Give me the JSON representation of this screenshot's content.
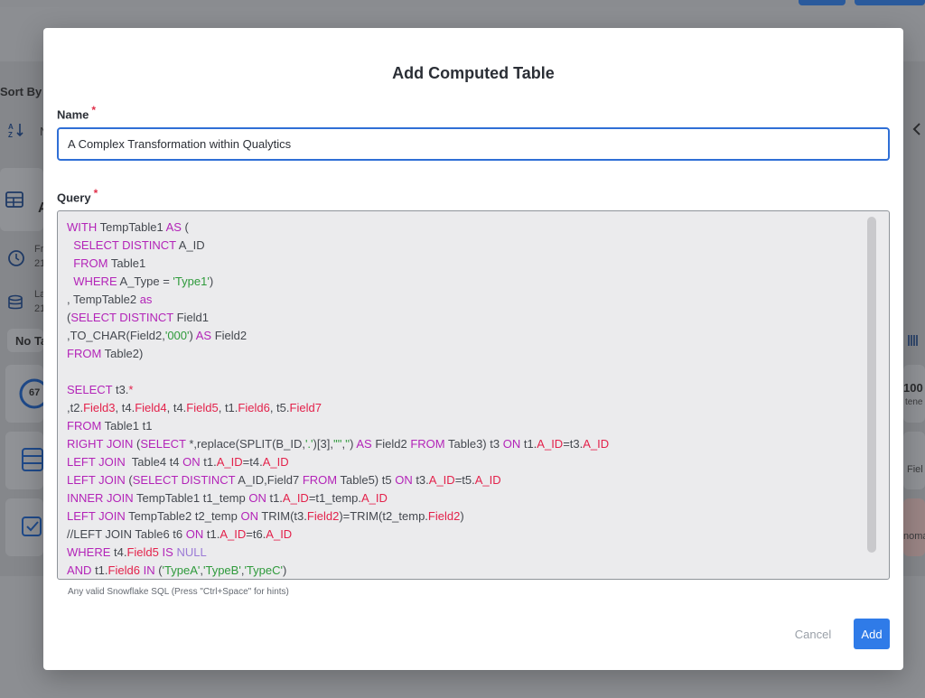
{
  "background": {
    "sort_label": "Sort By",
    "no_tags_label": "No Ta",
    "metric_value": "67",
    "right_metric": "100",
    "right_sub": "tene",
    "right_field": "Fiel",
    "right_anomaly": "noma",
    "side_letter": "A",
    "fr_label": "Fr",
    "fr_value": "21",
    "la_label": "La",
    "la_value": "21",
    "n_label": "N"
  },
  "modal": {
    "title": "Add Computed Table",
    "name_label": "Name",
    "name_value": "A Complex Transformation within Qualytics",
    "query_label": "Query",
    "required_mark": "*",
    "hint": "Any valid Snowflake SQL (Press \"Ctrl+Space\" for hints)",
    "cancel_label": "Cancel",
    "add_label": "Add"
  },
  "query_lines": [
    [
      {
        "t": "WITH",
        "c": "kw"
      },
      {
        "t": " TempTable1 ",
        "c": ""
      },
      {
        "t": "AS",
        "c": "kw"
      },
      {
        "t": " (",
        "c": ""
      }
    ],
    [
      {
        "t": "  SELECT DISTINCT",
        "c": "kw"
      },
      {
        "t": " A_ID",
        "c": ""
      }
    ],
    [
      {
        "t": "  FROM",
        "c": "kw"
      },
      {
        "t": " Table1",
        "c": ""
      }
    ],
    [
      {
        "t": "  WHERE",
        "c": "kw"
      },
      {
        "t": " A_Type = ",
        "c": ""
      },
      {
        "t": "'Type1'",
        "c": "st"
      },
      {
        "t": ")",
        "c": ""
      }
    ],
    [
      {
        "t": ", TempTable2 ",
        "c": ""
      },
      {
        "t": "as",
        "c": "kw"
      }
    ],
    [
      {
        "t": "(",
        "c": ""
      },
      {
        "t": "SELECT DISTINCT",
        "c": "kw"
      },
      {
        "t": " Field1",
        "c": ""
      }
    ],
    [
      {
        "t": ",TO_CHAR(Field2,",
        "c": ""
      },
      {
        "t": "'000'",
        "c": "st"
      },
      {
        "t": ") ",
        "c": ""
      },
      {
        "t": "AS",
        "c": "kw"
      },
      {
        "t": " Field2",
        "c": ""
      }
    ],
    [
      {
        "t": "FROM",
        "c": "kw"
      },
      {
        "t": " Table2)",
        "c": ""
      }
    ],
    [],
    [
      {
        "t": "SELECT",
        "c": "kw"
      },
      {
        "t": " t3.",
        "c": ""
      },
      {
        "t": "*",
        "c": "fd"
      }
    ],
    [
      {
        "t": ",t2.",
        "c": ""
      },
      {
        "t": "Field3",
        "c": "fd"
      },
      {
        "t": ", t4.",
        "c": ""
      },
      {
        "t": "Field4",
        "c": "fd"
      },
      {
        "t": ", t4.",
        "c": ""
      },
      {
        "t": "Field5",
        "c": "fd"
      },
      {
        "t": ", t1.",
        "c": ""
      },
      {
        "t": "Field6",
        "c": "fd"
      },
      {
        "t": ", t5.",
        "c": ""
      },
      {
        "t": "Field7",
        "c": "fd"
      }
    ],
    [
      {
        "t": "FROM",
        "c": "kw"
      },
      {
        "t": " Table1 t1",
        "c": ""
      }
    ],
    [
      {
        "t": "RIGHT JOIN",
        "c": "kw"
      },
      {
        "t": " (",
        "c": ""
      },
      {
        "t": "SELECT",
        "c": "kw"
      },
      {
        "t": " *,replace(SPLIT(B_ID,",
        "c": ""
      },
      {
        "t": "'.'",
        "c": "st"
      },
      {
        "t": ")[3],",
        "c": ""
      },
      {
        "t": "'\"'",
        "c": "st"
      },
      {
        "t": ",",
        "c": ""
      },
      {
        "t": "''",
        "c": "st"
      },
      {
        "t": ") ",
        "c": ""
      },
      {
        "t": "AS",
        "c": "kw"
      },
      {
        "t": " Field2 ",
        "c": ""
      },
      {
        "t": "FROM",
        "c": "kw"
      },
      {
        "t": " Table3) t3 ",
        "c": ""
      },
      {
        "t": "ON",
        "c": "kw"
      },
      {
        "t": " t1.",
        "c": ""
      },
      {
        "t": "A_ID",
        "c": "fd"
      },
      {
        "t": "=t3.",
        "c": ""
      },
      {
        "t": "A_ID",
        "c": "fd"
      }
    ],
    [
      {
        "t": "LEFT JOIN",
        "c": "kw"
      },
      {
        "t": "  Table4 t4 ",
        "c": ""
      },
      {
        "t": "ON",
        "c": "kw"
      },
      {
        "t": " t1.",
        "c": ""
      },
      {
        "t": "A_ID",
        "c": "fd"
      },
      {
        "t": "=t4.",
        "c": ""
      },
      {
        "t": "A_ID",
        "c": "fd"
      }
    ],
    [
      {
        "t": "LEFT JOIN",
        "c": "kw"
      },
      {
        "t": " (",
        "c": ""
      },
      {
        "t": "SELECT DISTINCT",
        "c": "kw"
      },
      {
        "t": " A_ID,Field7 ",
        "c": ""
      },
      {
        "t": "FROM",
        "c": "kw"
      },
      {
        "t": " Table5) t5 ",
        "c": ""
      },
      {
        "t": "ON",
        "c": "kw"
      },
      {
        "t": " t3.",
        "c": ""
      },
      {
        "t": "A_ID",
        "c": "fd"
      },
      {
        "t": "=t5.",
        "c": ""
      },
      {
        "t": "A_ID",
        "c": "fd"
      }
    ],
    [
      {
        "t": "INNER JOIN",
        "c": "kw"
      },
      {
        "t": " TempTable1 t1_temp ",
        "c": ""
      },
      {
        "t": "ON",
        "c": "kw"
      },
      {
        "t": " t1.",
        "c": ""
      },
      {
        "t": "A_ID",
        "c": "fd"
      },
      {
        "t": "=t1_temp.",
        "c": ""
      },
      {
        "t": "A_ID",
        "c": "fd"
      }
    ],
    [
      {
        "t": "LEFT JOIN",
        "c": "kw"
      },
      {
        "t": " TempTable2 t2_temp ",
        "c": ""
      },
      {
        "t": "ON",
        "c": "kw"
      },
      {
        "t": " TRIM(t3.",
        "c": ""
      },
      {
        "t": "Field2",
        "c": "fd"
      },
      {
        "t": ")=TRIM(t2_temp.",
        "c": ""
      },
      {
        "t": "Field2",
        "c": "fd"
      },
      {
        "t": ")",
        "c": ""
      }
    ],
    [
      {
        "t": "//LEFT JOIN",
        "c": ""
      },
      {
        "t": " Table6 t6 ",
        "c": ""
      },
      {
        "t": "ON",
        "c": "kw"
      },
      {
        "t": " t1.",
        "c": ""
      },
      {
        "t": "A_ID",
        "c": "fd"
      },
      {
        "t": "=t6.",
        "c": ""
      },
      {
        "t": "A_ID",
        "c": "fd"
      }
    ],
    [
      {
        "t": "WHERE",
        "c": "kw"
      },
      {
        "t": " t4.",
        "c": ""
      },
      {
        "t": "Field5",
        "c": "fd"
      },
      {
        "t": " ",
        "c": ""
      },
      {
        "t": "IS",
        "c": "kw"
      },
      {
        "t": " ",
        "c": ""
      },
      {
        "t": "NULL",
        "c": "nl"
      }
    ],
    [
      {
        "t": "AND",
        "c": "kw"
      },
      {
        "t": " t1.",
        "c": ""
      },
      {
        "t": "Field6",
        "c": "fd"
      },
      {
        "t": " ",
        "c": ""
      },
      {
        "t": "IN",
        "c": "kw"
      },
      {
        "t": " (",
        "c": ""
      },
      {
        "t": "'TypeA'",
        "c": "st"
      },
      {
        "t": ",",
        "c": ""
      },
      {
        "t": "'TypeB'",
        "c": "st"
      },
      {
        "t": ",",
        "c": ""
      },
      {
        "t": "'TypeC'",
        "c": "st"
      },
      {
        "t": ")",
        "c": ""
      }
    ]
  ],
  "colors": {
    "primary": "#2f7be8",
    "keyword": "#b324b8",
    "field": "#e3224b",
    "string": "#2e9a3b",
    "required": "#e0304a"
  }
}
